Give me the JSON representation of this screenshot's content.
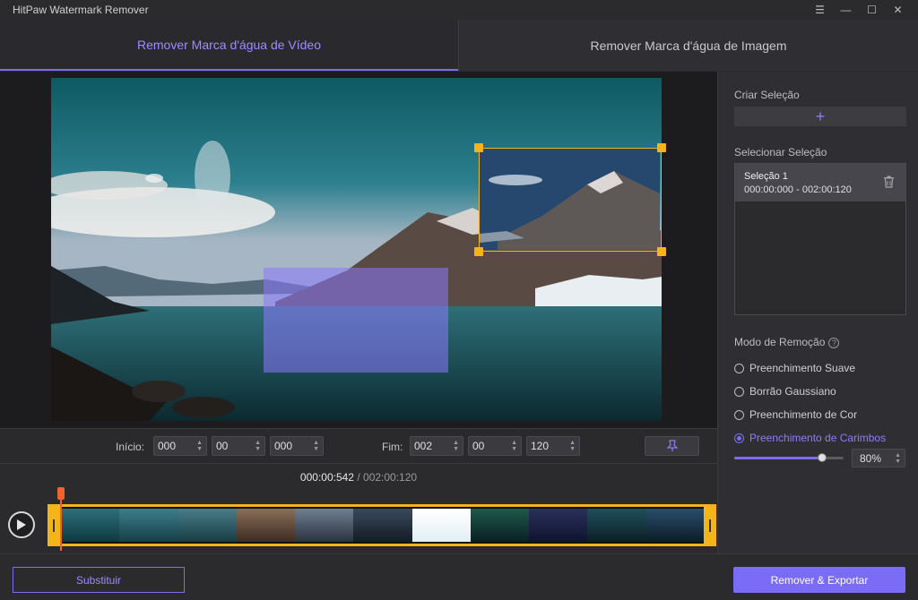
{
  "window": {
    "title": "HitPaw Watermark Remover",
    "controls": {
      "menu": "☰",
      "minimize": "—",
      "maximize": "☐",
      "close": "✕"
    }
  },
  "tabs": [
    {
      "label": "Remover Marca d'água de Vídeo",
      "active": true
    },
    {
      "label": "Remover Marca d'água de Imagem",
      "active": false
    }
  ],
  "time_inputs": {
    "start_label": "Início:",
    "start": [
      "000",
      "00",
      "000"
    ],
    "end_label": "Fim:",
    "end": [
      "002",
      "00",
      "120"
    ]
  },
  "playback": {
    "current": "000:00:542",
    "separator": "/",
    "total": "002:00:120"
  },
  "right_panel": {
    "create_selection_label": "Criar Seleção",
    "add_selection_symbol": "+",
    "select_selection_label": "Selecionar Seleção",
    "selections": [
      {
        "name": "Seleção 1",
        "range": "000:00:000 - 002:00:120"
      }
    ],
    "removal_mode_label": "Modo de Remoção",
    "help_symbol": "?",
    "modes": [
      {
        "label": "Preenchimento Suave",
        "checked": false
      },
      {
        "label": "Borrão Gaussiano",
        "checked": false
      },
      {
        "label": "Preenchimento de Cor",
        "checked": false
      },
      {
        "label": "Preenchimento de Carimbos",
        "checked": true
      }
    ],
    "opacity_value": "80%",
    "opacity_fraction": 0.8
  },
  "buttons": {
    "replace": "Substituir",
    "export": "Remover & Exportar"
  },
  "colors": {
    "accent": "#7b6cf6",
    "selection_handle": "#f3b51a",
    "playhead": "#f0622e"
  }
}
